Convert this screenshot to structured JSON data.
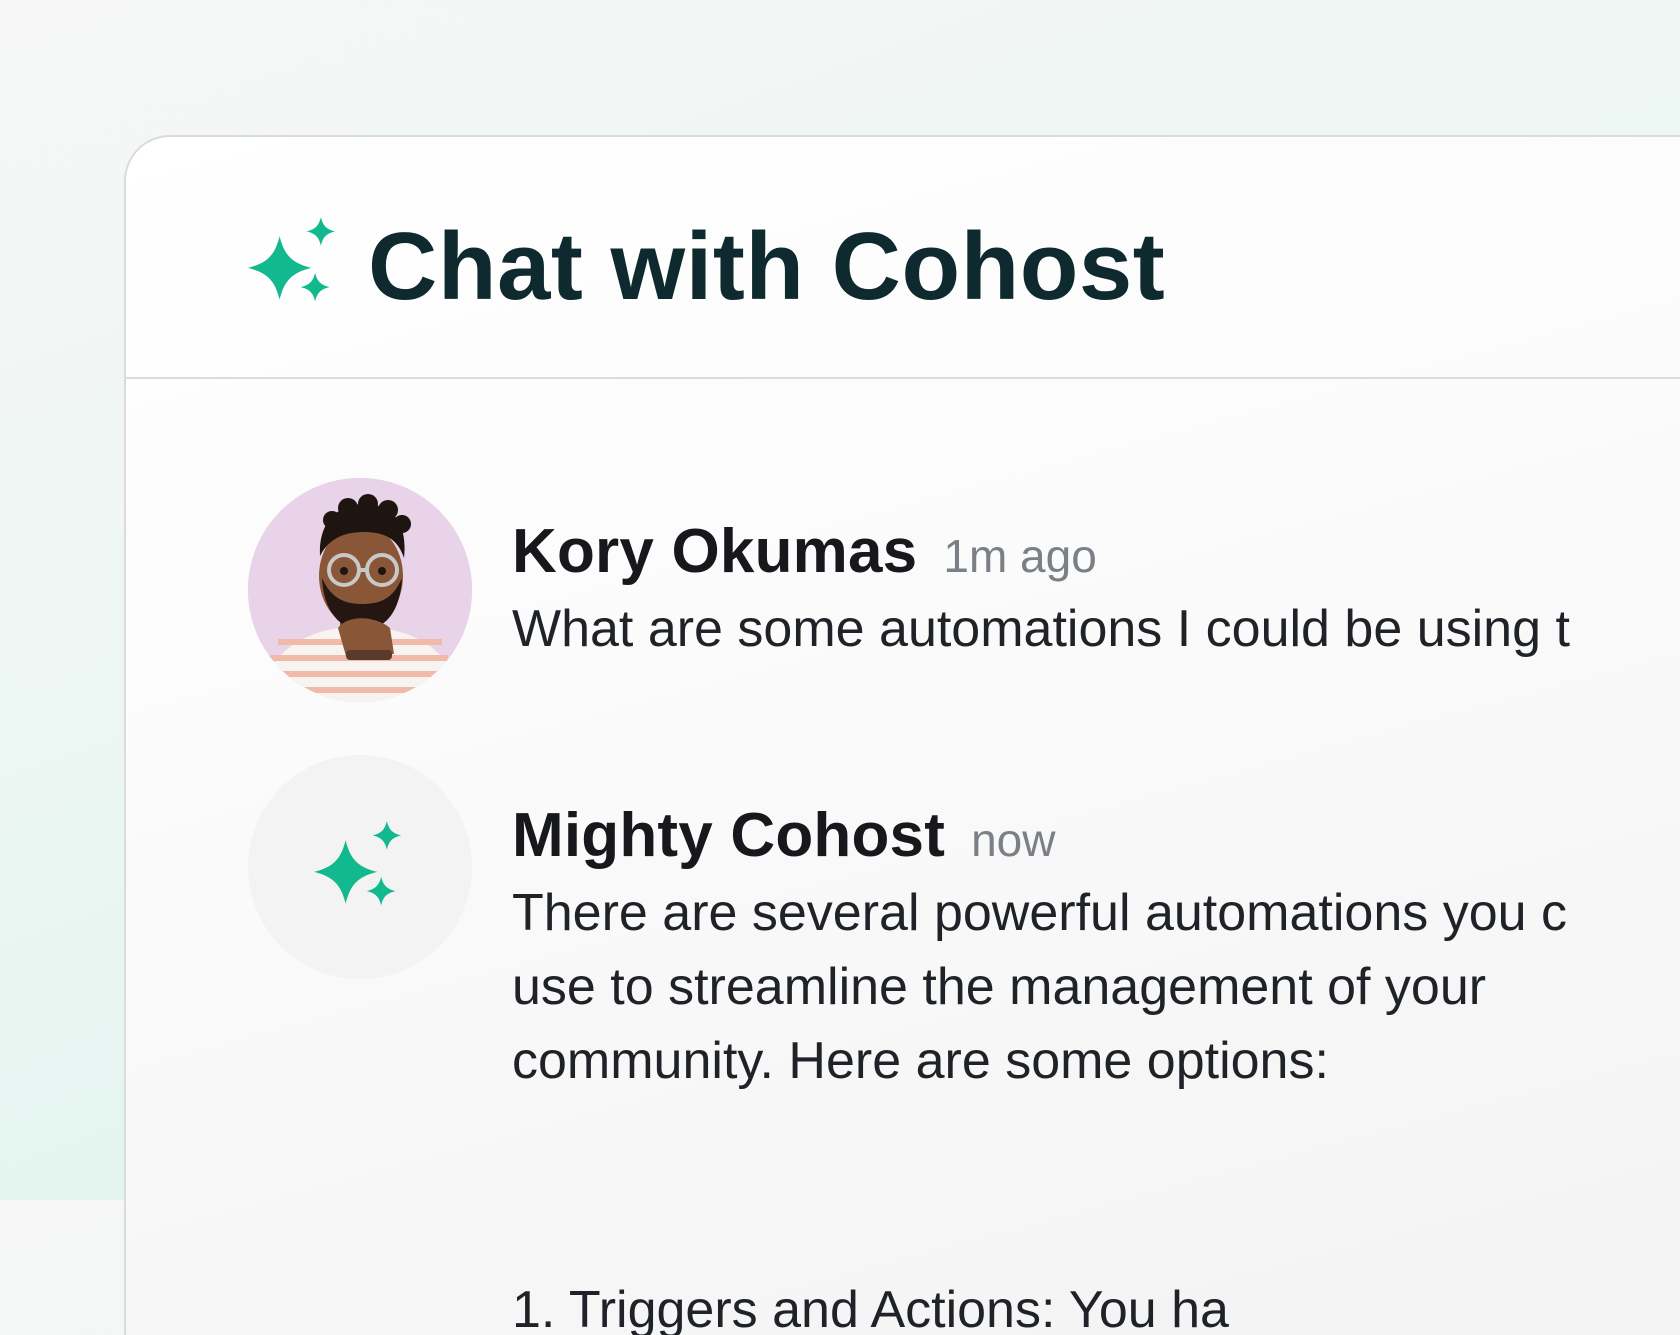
{
  "header": {
    "title": "Chat with Cohost",
    "icon": "sparkles-icon",
    "accent_color": "#12b98f"
  },
  "messages": [
    {
      "author": "Kory Okumas",
      "time": "1m ago",
      "avatar": "user-photo",
      "text": "What are some automations I could be using t"
    },
    {
      "author": "Mighty Cohost",
      "time": "now",
      "avatar": "sparkles-icon",
      "lines": [
        "There are several powerful automations you c",
        "use to streamline the management of your",
        "community. Here are some options:"
      ],
      "list_start": "1. Triggers and Actions: You ha"
    }
  ]
}
